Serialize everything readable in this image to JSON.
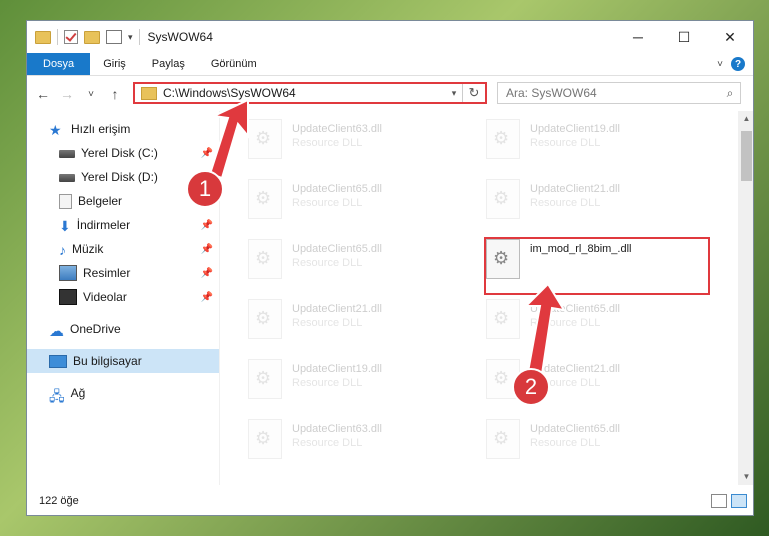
{
  "window": {
    "title": "SysWOW64",
    "controls": {
      "minimize": "─",
      "maximize": "☐",
      "close": "✕"
    }
  },
  "ribbon": {
    "tabs": [
      "Dosya",
      "Giriş",
      "Paylaş",
      "Görünüm"
    ],
    "help": "?"
  },
  "nav": {
    "back": "←",
    "forward": "→",
    "recent": "˅",
    "up": "↑",
    "address": "C:\\Windows\\SysWOW64",
    "refresh": "↻",
    "search_placeholder": "Ara: SysWOW64"
  },
  "sidebar": {
    "quick_access": "Hızlı erişim",
    "items": [
      {
        "label": "Yerel Disk (C:)",
        "pinned": true
      },
      {
        "label": "Yerel Disk (D:)",
        "pinned": false
      },
      {
        "label": "Belgeler",
        "pinned": true
      },
      {
        "label": "İndirmeler",
        "pinned": true
      },
      {
        "label": "Müzik",
        "pinned": true
      },
      {
        "label": "Resimler",
        "pinned": true
      },
      {
        "label": "Videolar",
        "pinned": true
      }
    ],
    "onedrive": "OneDrive",
    "this_pc": "Bu bilgisayar",
    "network": "Ağ"
  },
  "files": {
    "left_column": [
      {
        "name": "UpdateClient63.dll",
        "type": "Resource DLL"
      },
      {
        "name": "UpdateClient65.dll",
        "type": "Resource DLL"
      },
      {
        "name": "UpdateClient65.dll",
        "type": "Resource DLL"
      },
      {
        "name": "UpdateClient21.dll",
        "type": "Resource DLL"
      },
      {
        "name": "UpdateClient19.dll",
        "type": "Resource DLL"
      },
      {
        "name": "UpdateClient63.dll",
        "type": "Resource DLL"
      }
    ],
    "right_column": [
      {
        "name": "UpdateClient19.dll",
        "type": "Resource DLL"
      },
      {
        "name": "UpdateClient21.dll",
        "type": "Resource DLL"
      },
      {
        "name": "im_mod_rl_8bim_.dll",
        "type": ""
      },
      {
        "name": "UpdateClient65.dll",
        "type": "Resource DLL"
      },
      {
        "name": "UpdateClient21.dll",
        "type": "Resource DLL"
      },
      {
        "name": "UpdateClient65.dll",
        "type": "Resource DLL"
      }
    ]
  },
  "status": {
    "item_count": "122 öğe"
  },
  "annotations": {
    "step1": "1",
    "step2": "2",
    "color": "#e0393e"
  }
}
